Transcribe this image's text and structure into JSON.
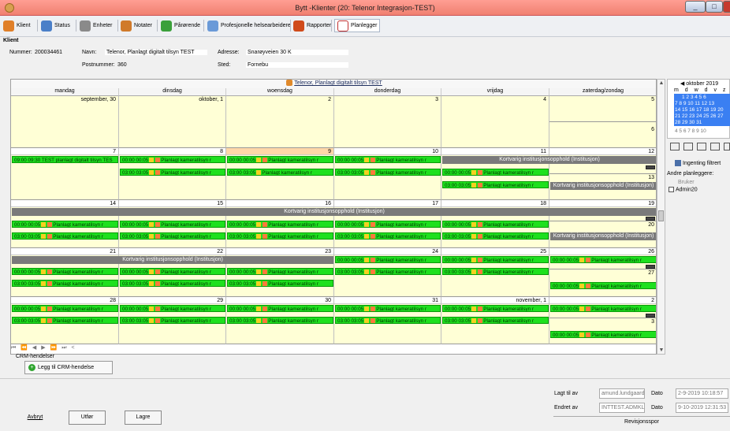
{
  "window": {
    "title": "Bytt -Klienter (20: Telenor Integrasjon-TEST)"
  },
  "toolbar": {
    "items": [
      {
        "label": "Klient",
        "icon": "person-icon",
        "color": "#e0802a"
      },
      {
        "label": "Status",
        "icon": "people-icon",
        "color": "#4a7fc8"
      },
      {
        "label": "Enheter",
        "icon": "folder-icon",
        "color": "#8a8a8a"
      },
      {
        "label": "Notater",
        "icon": "notes-icon",
        "color": "#d07a2a"
      },
      {
        "label": "Pårørende",
        "icon": "relatives-icon",
        "color": "#3aa03a"
      },
      {
        "label": "Profesjonelle helsearbeidere",
        "icon": "health-worker-icon",
        "color": "#6a9ad8"
      },
      {
        "label": "Rapporter",
        "icon": "report-icon",
        "color": "#d04a1a"
      },
      {
        "label": "Planlegger",
        "icon": "calendar-icon",
        "color": "#c03030"
      }
    ]
  },
  "client": {
    "section_title": "Klient",
    "nummer_label": "Nummer:",
    "nummer_value": "200034461",
    "navn_label": "Navn:",
    "navn_value": "Telenor, Planlagt digitalt tilsyn TEST",
    "adresse_label": "Adresse:",
    "adresse_value": "Snarøyveien 30 K",
    "postnummer_label": "Postnummer:",
    "postnummer_value": "360",
    "sted_label": "Sted:",
    "sted_value": "Fornebu"
  },
  "calendar": {
    "title": "Telenor, Planlagt digitalt tilsyn TEST",
    "weekdays": [
      "mandag",
      "dinsdag",
      "woensdag",
      "donderdag",
      "vrijdag",
      "zaterdag/zondag"
    ],
    "week1": {
      "dates": [
        "september, 30",
        "oktober, 1",
        "2",
        "3",
        "4"
      ],
      "sat": "5",
      "sun": "6"
    },
    "week2": {
      "dates": [
        "7",
        "8",
        "9",
        "10",
        "11"
      ],
      "sat": "12",
      "sun": "13",
      "mon_ev1": "09:00 09:30 TEST planlagt digitalt tilsyn TES",
      "ev_a": "00:00 00:05",
      "ev_b": "03:00 03:05",
      "ev_label": "Planlagt kameratilsyn r",
      "fri_gray": "Kortvarig institusjonsopphold (Institusjon)",
      "sun_gray": "Kortvarig institusjonsopphold (Institusjon)"
    },
    "week3": {
      "dates": [
        "14",
        "15",
        "16",
        "17",
        "18"
      ],
      "sat": "19",
      "sun": "20",
      "gray": "Kortvarig institusjonsopphold (Institusjon)",
      "sun_gray": "Kortvarig institusjonsopphold (Institusjon)"
    },
    "week4": {
      "dates": [
        "21",
        "22",
        "23",
        "24",
        "25"
      ],
      "sat": "26",
      "sun": "27",
      "gray": "Kortvarig institusjonsopphold (Institusjon)"
    },
    "week5": {
      "dates": [
        "28",
        "29",
        "30",
        "31",
        "november, 1"
      ],
      "sat": "2",
      "sun": "3"
    },
    "nav": "⏮ ⏪ ◀ ▶ ⏩ ⏭ <"
  },
  "minical": {
    "month": "oktober 2019",
    "days_header": "m d w d v z z",
    "rows": [
      "1  2  3  4  5  6",
      "7  8  9 10 11 12 13",
      "14 15 16 17 18 19 20",
      "21 22 23 24 25 26 27",
      "28 29 30 31",
      "4  5  6  7  8  9 10"
    ]
  },
  "right": {
    "filter": "Ingenting filtrert",
    "andre": "Andre planleggere:",
    "bruker": "Bruker",
    "user1": "Admin20"
  },
  "crm": {
    "label": "CRM-hendelser",
    "button": "Legg til CRM-hendelse"
  },
  "footer": {
    "lagt_label": "Lagt til av",
    "lagt_value": "amund.lundgaard",
    "dato1_label": "Dato",
    "dato1_value": "2-9-2019 10:18:57",
    "endret_label": "Endret av",
    "endret_value": "INTTEST.ADMKL",
    "dato2_label": "Dato",
    "dato2_value": "9-10-2019 12:31:53",
    "revisjon": "Revisjonsspor",
    "avbryt": "Avbryt",
    "utfor": "Utfør",
    "lagre": "Lagre"
  }
}
